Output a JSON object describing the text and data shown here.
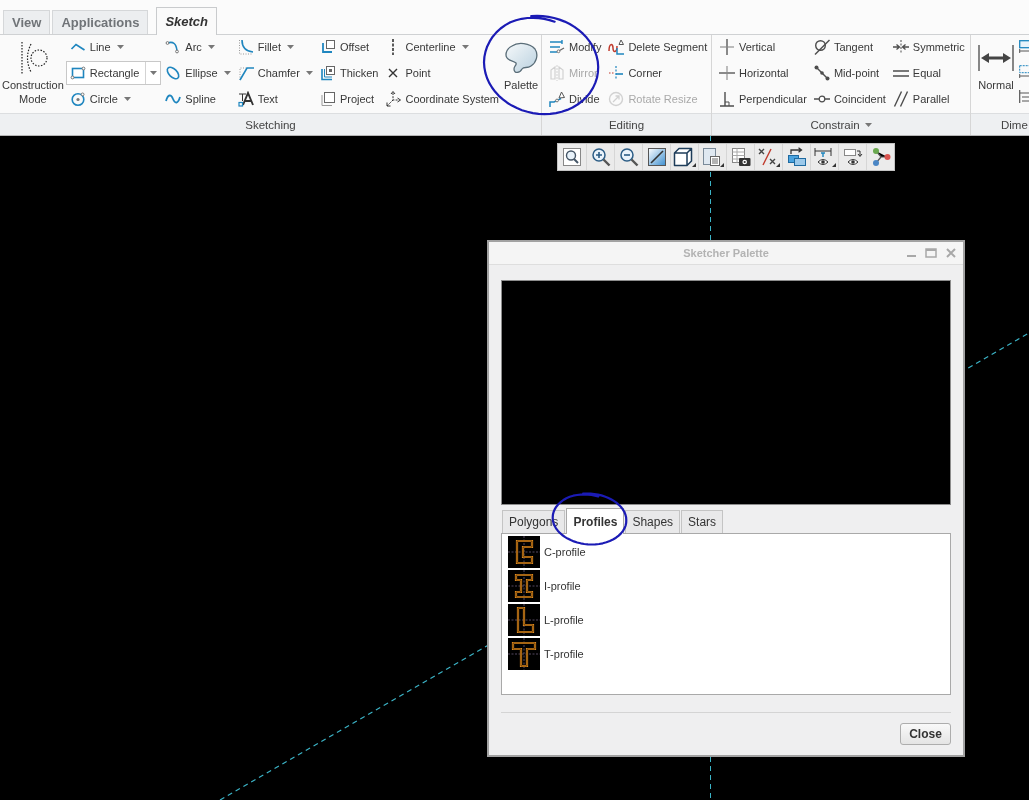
{
  "ribbon": {
    "tabs": [
      {
        "label": "View",
        "selected": false
      },
      {
        "label": "Applications",
        "selected": false
      },
      {
        "label": "Sketch",
        "selected": true
      }
    ],
    "groups": [
      {
        "label": "Sketching",
        "dropdown": false,
        "columns": [
          {
            "kind": "large",
            "label": "Construction Mode",
            "circled": false
          },
          {
            "kind": "stack",
            "items": [
              {
                "label": "Line",
                "dropdown": true,
                "disabled": false,
                "hovered": false
              },
              {
                "label": "Rectangle",
                "dropdown": true,
                "disabled": false,
                "hovered": true
              },
              {
                "label": "Circle",
                "dropdown": true,
                "disabled": false,
                "hovered": false
              }
            ]
          },
          {
            "kind": "stack",
            "items": [
              {
                "label": "Arc",
                "dropdown": true,
                "disabled": false,
                "hovered": false
              },
              {
                "label": "Ellipse",
                "dropdown": true,
                "disabled": false,
                "hovered": false
              },
              {
                "label": "Spline",
                "dropdown": false,
                "disabled": false,
                "hovered": false
              }
            ]
          },
          {
            "kind": "stack",
            "items": [
              {
                "label": "Fillet",
                "dropdown": true,
                "disabled": false,
                "hovered": false
              },
              {
                "label": "Chamfer",
                "dropdown": true,
                "disabled": false,
                "hovered": false
              },
              {
                "label": "Text",
                "dropdown": false,
                "disabled": false,
                "hovered": false
              }
            ]
          },
          {
            "kind": "stack",
            "items": [
              {
                "label": "Offset",
                "dropdown": false,
                "disabled": false,
                "hovered": false
              },
              {
                "label": "Thicken",
                "dropdown": false,
                "disabled": false,
                "hovered": false
              },
              {
                "label": "Project",
                "dropdown": false,
                "disabled": false,
                "hovered": false
              }
            ]
          },
          {
            "kind": "stack",
            "items": [
              {
                "label": "Centerline",
                "dropdown": true,
                "disabled": false,
                "hovered": false
              },
              {
                "label": "Point",
                "dropdown": false,
                "disabled": false,
                "hovered": false
              },
              {
                "label": "Coordinate System",
                "dropdown": false,
                "disabled": false,
                "hovered": false
              }
            ]
          },
          {
            "kind": "large",
            "label": "Palette",
            "circled": true
          }
        ]
      },
      {
        "label": "Editing",
        "dropdown": false,
        "columns": [
          {
            "kind": "stack",
            "items": [
              {
                "label": "Modify",
                "dropdown": false,
                "disabled": false,
                "hovered": false
              },
              {
                "label": "Mirror",
                "dropdown": false,
                "disabled": true,
                "hovered": false
              },
              {
                "label": "Divide",
                "dropdown": false,
                "disabled": false,
                "hovered": false
              }
            ]
          },
          {
            "kind": "stack",
            "items": [
              {
                "label": "Delete Segment",
                "dropdown": false,
                "disabled": false,
                "hovered": false
              },
              {
                "label": "Corner",
                "dropdown": false,
                "disabled": false,
                "hovered": false
              },
              {
                "label": "Rotate Resize",
                "dropdown": false,
                "disabled": true,
                "hovered": false
              }
            ]
          }
        ]
      },
      {
        "label": "Constrain",
        "dropdown": true,
        "columns": [
          {
            "kind": "stack",
            "items": [
              {
                "label": "Vertical",
                "dropdown": false,
                "disabled": false,
                "hovered": false
              },
              {
                "label": "Horizontal",
                "dropdown": false,
                "disabled": false,
                "hovered": false
              },
              {
                "label": "Perpendicular",
                "dropdown": false,
                "disabled": false,
                "hovered": false
              }
            ]
          },
          {
            "kind": "stack",
            "items": [
              {
                "label": "Tangent",
                "dropdown": false,
                "disabled": false,
                "hovered": false
              },
              {
                "label": "Mid-point",
                "dropdown": false,
                "disabled": false,
                "hovered": false
              },
              {
                "label": "Coincident",
                "dropdown": false,
                "disabled": false,
                "hovered": false
              }
            ]
          },
          {
            "kind": "stack",
            "items": [
              {
                "label": "Symmetric",
                "dropdown": false,
                "disabled": false,
                "hovered": false
              },
              {
                "label": "Equal",
                "dropdown": false,
                "disabled": false,
                "hovered": false
              },
              {
                "label": "Parallel",
                "dropdown": false,
                "disabled": false,
                "hovered": false
              }
            ]
          }
        ]
      },
      {
        "label": "Dime",
        "dropdown": false,
        "columns": [
          {
            "kind": "large",
            "label": "Normal",
            "circled": false
          },
          {
            "kind": "icons",
            "items": [
              {
                "disabled": false
              },
              {
                "disabled": false
              },
              {
                "disabled": false
              }
            ]
          }
        ]
      }
    ]
  },
  "view_toolbar": {
    "buttons": [
      {
        "dropdown": false
      },
      {
        "dropdown": false
      },
      {
        "dropdown": false
      },
      {
        "dropdown": false
      },
      {
        "dropdown": true
      },
      {
        "dropdown": true
      },
      {
        "dropdown": false
      },
      {
        "dropdown": true
      },
      {
        "dropdown": false
      },
      {
        "dropdown": true
      },
      {
        "dropdown": false
      },
      {
        "dropdown": false
      }
    ]
  },
  "dialog": {
    "title": "Sketcher Palette",
    "tabs": [
      {
        "label": "Polygons",
        "selected": false,
        "circled": false
      },
      {
        "label": "Profiles",
        "selected": true,
        "circled": true
      },
      {
        "label": "Shapes",
        "selected": false,
        "circled": false
      },
      {
        "label": "Stars",
        "selected": false,
        "circled": false
      }
    ],
    "items": [
      {
        "label": "C-profile"
      },
      {
        "label": "I-profile"
      },
      {
        "label": "L-profile"
      },
      {
        "label": "T-profile"
      }
    ],
    "buttons": [
      "Close"
    ]
  }
}
